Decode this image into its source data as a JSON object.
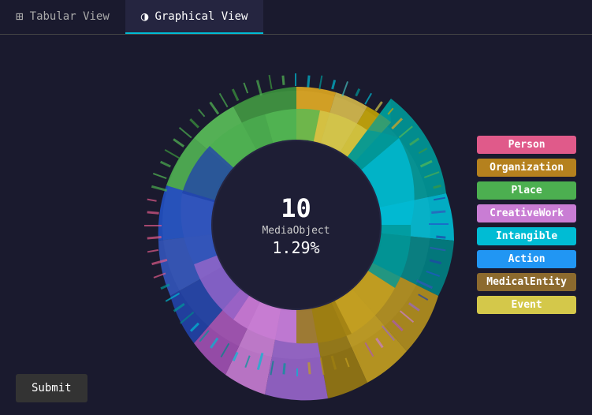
{
  "tabs": [
    {
      "id": "tabular",
      "label": "Tabular View",
      "icon": "⊞",
      "active": false
    },
    {
      "id": "graphical",
      "label": "Graphical View",
      "icon": "◑",
      "active": true
    }
  ],
  "chart": {
    "center": {
      "number": "10",
      "label": "MediaObject",
      "percent": "1.29%"
    }
  },
  "legend": [
    {
      "label": "Person",
      "color": "#e05a8a"
    },
    {
      "label": "Organization",
      "color": "#b5811e"
    },
    {
      "label": "Place",
      "color": "#4caf50"
    },
    {
      "label": "CreativeWork",
      "color": "#c97dd4"
    },
    {
      "label": "Intangible",
      "color": "#00bcd4"
    },
    {
      "label": "Action",
      "color": "#2196f3"
    },
    {
      "label": "MedicalEntity",
      "color": "#8c6a2e"
    },
    {
      "label": "Event",
      "color": "#d4c84a"
    }
  ],
  "submit_label": "Submit"
}
